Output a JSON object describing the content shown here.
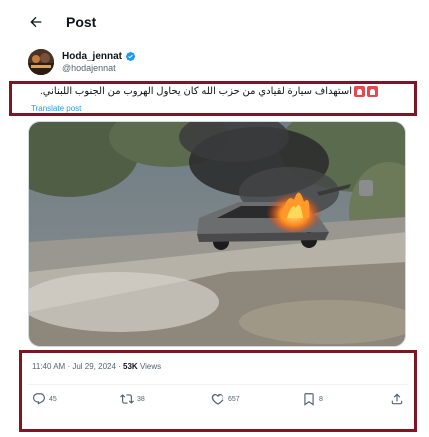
{
  "header": {
    "title": "Post",
    "back_icon": "arrow-left-icon"
  },
  "author": {
    "display_name": "Hoda_jennat",
    "handle": "@hodajennat",
    "verified_icon": "verified-badge-icon",
    "verified_color": "#1d9bf0"
  },
  "tweet": {
    "text": "استهداف سيارة لقيادي من حزب الله كان يحاول الهروب من الجنوب اللبناني.",
    "emoji_icon": "police-light-icon",
    "translate_label": "Translate post"
  },
  "media": {
    "description_icon": "burning-car-photo"
  },
  "meta": {
    "time": "11:40 AM",
    "separator": " · ",
    "date": "Jul 29, 2024",
    "views_count": "53K",
    "views_label": " Views"
  },
  "actions": {
    "replies": "45",
    "reposts": "38",
    "likes": "657",
    "bookmarks": "8"
  },
  "colors": {
    "highlight_border": "#7d1525",
    "link": "#1d9bf0",
    "muted": "#536471"
  }
}
